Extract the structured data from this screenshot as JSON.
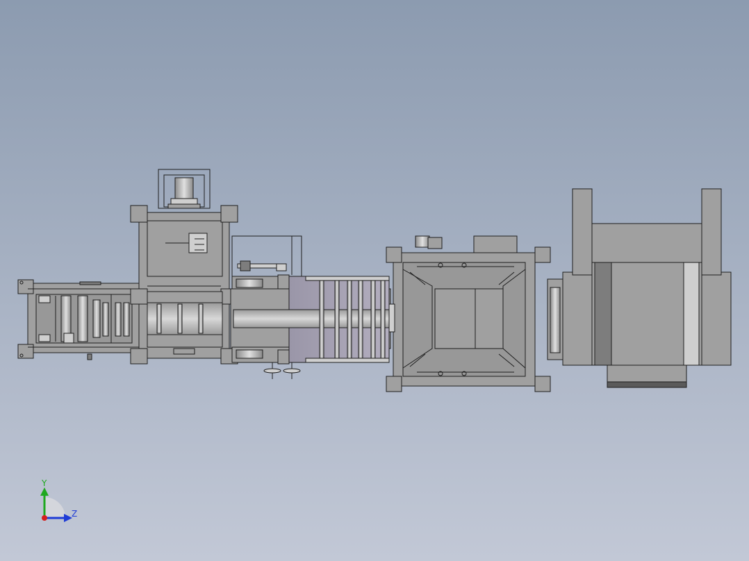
{
  "scene": {
    "background_top": "#8c9bb0",
    "background_bottom": "#c2c8d6",
    "part_fill": "#a0a0a0",
    "part_fill_dark": "#7d7d7d",
    "part_fill_light": "#cfcfcf",
    "edge_color": "#1e1e1e",
    "roller_fill": "#bdbdbd",
    "interior_fill": "#989898"
  },
  "triad": {
    "y_label": "Y",
    "z_label": "Z",
    "y_color": "#1fa81f",
    "z_color": "#1f3cd6",
    "x_color": "#d41f1f"
  }
}
